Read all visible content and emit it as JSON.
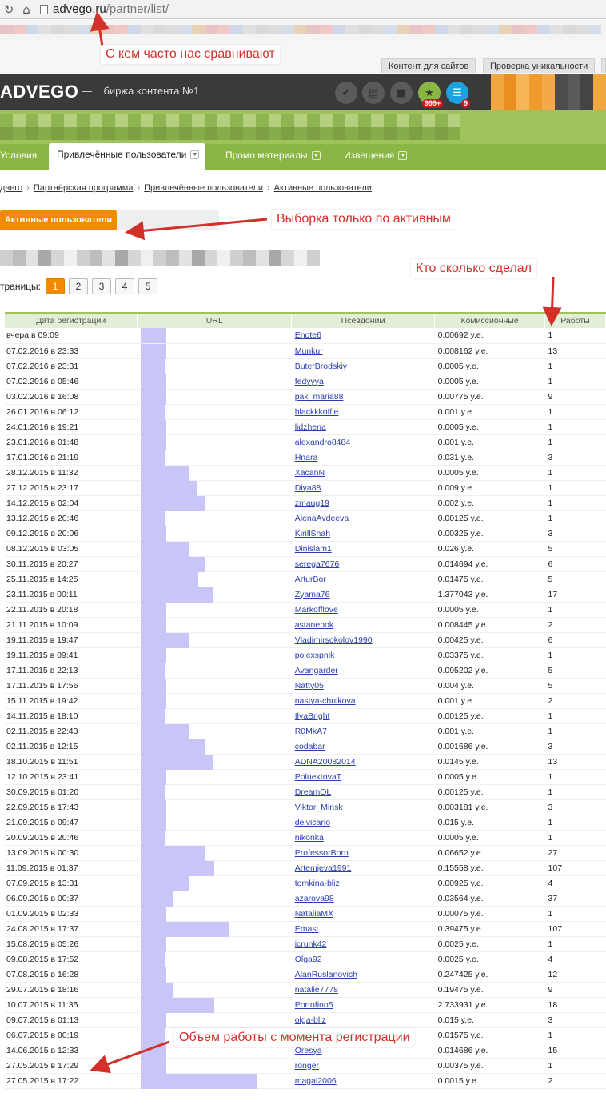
{
  "browser": {
    "url_host": "advego.ru",
    "url_path": "/partner/list/"
  },
  "top_tabs": [
    "Контент для сайтов",
    "Проверка уникальности"
  ],
  "annotations": {
    "compare": "С кем часто нас сравнивают",
    "active_only": "Выборка только по активным",
    "who_did": "Кто сколько сделал",
    "volume": "Объем работы с момента регистрации"
  },
  "header": {
    "logo": "ADVEGO",
    "dash": "—",
    "slogan": "биржа контента №1",
    "badge_star": "999+",
    "badge_list": "9",
    "icons": [
      "check-icon",
      "document-icon",
      "folder-icon",
      "star-icon",
      "list-icon"
    ]
  },
  "nav": {
    "items": [
      {
        "label": "Условия",
        "dropdown": false,
        "active": false
      },
      {
        "label": "Привлечённые пользователи",
        "dropdown": true,
        "active": true
      },
      {
        "label": "Промо материалы",
        "dropdown": true,
        "active": false
      },
      {
        "label": "Извещения",
        "dropdown": true,
        "active": false
      }
    ]
  },
  "breadcrumb": [
    "двего",
    "Партнёрская программа",
    "Привлечённые пользователи",
    "Активные пользователи"
  ],
  "filter_button": "Активные пользователи",
  "pagination": {
    "label": "траницы:",
    "pages": [
      "1",
      "2",
      "3",
      "4",
      "5"
    ],
    "current": "1"
  },
  "table": {
    "headers": [
      "Дата регистрации",
      "URL",
      "Псевдоним",
      "Комиссионные",
      "Работы"
    ],
    "rows": [
      {
        "date": "вчера в 09:09",
        "nick": "Enote6",
        "comm": "0.00692 y.e.",
        "work": "1"
      },
      {
        "date": "07.02.2016 в 23:33",
        "nick": "Munkur",
        "comm": "0.008162 y.e.",
        "work": "13"
      },
      {
        "date": "07.02.2016 в 23:31",
        "nick": "ButerBrodskiy",
        "comm": "0.0005 y.e.",
        "work": "1"
      },
      {
        "date": "07.02.2016 в 05:46",
        "nick": "fedyyya",
        "comm": "0.0005 y.e.",
        "work": "1"
      },
      {
        "date": "03.02.2016 в 16:08",
        "nick": "pak_maria88",
        "comm": "0.00775 y.e.",
        "work": "9"
      },
      {
        "date": "26.01.2016 в 06:12",
        "nick": "blackkkoffie",
        "comm": "0.001 y.e.",
        "work": "1"
      },
      {
        "date": "24.01.2016 в 19:21",
        "nick": "lidzhena",
        "comm": "0.0005 y.e.",
        "work": "1"
      },
      {
        "date": "23.01.2016 в 01:48",
        "nick": "alexandro8484",
        "comm": "0.001 y.e.",
        "work": "1"
      },
      {
        "date": "17.01.2016 в 21:19",
        "nick": "Hnara",
        "comm": "0.031 y.e.",
        "work": "3"
      },
      {
        "date": "28.12.2015 в 11:32",
        "nick": "XacanN",
        "comm": "0.0005 y.e.",
        "work": "1"
      },
      {
        "date": "27.12.2015 в 23:17",
        "nick": "Diya88",
        "comm": "0.009 y.e.",
        "work": "1"
      },
      {
        "date": "14.12.2015 в 02:04",
        "nick": "zmaug19",
        "comm": "0.002 y.e.",
        "work": "1"
      },
      {
        "date": "13.12.2015 в 20:46",
        "nick": "AlenaAvdeeva",
        "comm": "0.00125 y.e.",
        "work": "1"
      },
      {
        "date": "09.12.2015 в 20:06",
        "nick": "KirillShah",
        "comm": "0.00325 y.e.",
        "work": "3"
      },
      {
        "date": "08.12.2015 в 03:05",
        "nick": "Dinislam1",
        "comm": "0.026 y.e.",
        "work": "5"
      },
      {
        "date": "30.11.2015 в 20:27",
        "nick": "serega7676",
        "comm": "0.014694 y.e.",
        "work": "6"
      },
      {
        "date": "25.11.2015 в 14:25",
        "nick": "ArturBor",
        "comm": "0.01475 y.e.",
        "work": "5"
      },
      {
        "date": "23.11.2015 в 00:11",
        "nick": "Zyama76",
        "comm": "1.377043 y.e.",
        "work": "17"
      },
      {
        "date": "22.11.2015 в 20:18",
        "nick": "Markofflove",
        "comm": "0.0005 y.e.",
        "work": "1"
      },
      {
        "date": "21.11.2015 в 10:09",
        "nick": "astanenok",
        "comm": "0.008445 y.e.",
        "work": "2"
      },
      {
        "date": "19.11.2015 в 19:47",
        "nick": "Vladimirsokolov1990",
        "comm": "0.00425 y.e.",
        "work": "6"
      },
      {
        "date": "19.11.2015 в 09:41",
        "nick": "polexspnik",
        "comm": "0.03375 y.e.",
        "work": "1"
      },
      {
        "date": "17.11.2015 в 22:13",
        "nick": "Avangarder",
        "comm": "0.095202 y.e.",
        "work": "5"
      },
      {
        "date": "17.11.2015 в 17:56",
        "nick": "Natty05",
        "comm": "0.004 y.e.",
        "work": "5"
      },
      {
        "date": "15.11.2015 в 19:42",
        "nick": "nastya-chulkova",
        "comm": "0.001 y.e.",
        "work": "2"
      },
      {
        "date": "14.11.2015 в 18:10",
        "nick": "IlyaBright",
        "comm": "0.00125 y.e.",
        "work": "1"
      },
      {
        "date": "02.11.2015 в 22:43",
        "nick": "R0MkA7",
        "comm": "0.001 y.e.",
        "work": "1"
      },
      {
        "date": "02.11.2015 в 12:15",
        "nick": "codabar",
        "comm": "0.001686 y.e.",
        "work": "3"
      },
      {
        "date": "18.10.2015 в 11:51",
        "nick": "ADNA20082014",
        "comm": "0.0145 y.e.",
        "work": "13"
      },
      {
        "date": "12.10.2015 в 23:41",
        "nick": "PoluektovaT",
        "comm": "0.0005 y.e.",
        "work": "1"
      },
      {
        "date": "30.09.2015 в 01:20",
        "nick": "DreamOL",
        "comm": "0.00125 y.e.",
        "work": "1"
      },
      {
        "date": "22.09.2015 в 17:43",
        "nick": "Viktor_Minsk",
        "comm": "0.003181 y.e.",
        "work": "3"
      },
      {
        "date": "21.09.2015 в 09:47",
        "nick": "delvicario",
        "comm": "0.015 y.e.",
        "work": "1"
      },
      {
        "date": "20.09.2015 в 20:46",
        "nick": "nikonka",
        "comm": "0.0005 y.e.",
        "work": "1"
      },
      {
        "date": "13.09.2015 в 00:30",
        "nick": "ProfessorBorn",
        "comm": "0.06652 y.e.",
        "work": "27"
      },
      {
        "date": "11.09.2015 в 01:37",
        "nick": "Artemjeva1991",
        "comm": "0.15558 y.e.",
        "work": "107"
      },
      {
        "date": "07.09.2015 в 13:31",
        "nick": "tomkina-bliz",
        "comm": "0.00925 y.e.",
        "work": "4"
      },
      {
        "date": "06.09.2015 в 00:37",
        "nick": "azarova98",
        "comm": "0.03564 y.e.",
        "work": "37"
      },
      {
        "date": "01.09.2015 в 02:33",
        "nick": "NataliaMX",
        "comm": "0.00075 y.e.",
        "work": "1"
      },
      {
        "date": "24.08.2015 в 17:37",
        "nick": "Emast",
        "comm": "0.39475 y.e.",
        "work": "107"
      },
      {
        "date": "15.08.2015 в 05:26",
        "nick": "icrunk42",
        "comm": "0.0025 y.e.",
        "work": "1"
      },
      {
        "date": "09.08.2015 в 17:52",
        "nick": "Olga92",
        "comm": "0.0025 y.e.",
        "work": "4"
      },
      {
        "date": "07.08.2015 в 16:28",
        "nick": "AlanRuslanovich",
        "comm": "0.247425 y.e.",
        "work": "12"
      },
      {
        "date": "29.07.2015 в 18:16",
        "nick": "natalie7778",
        "comm": "0.19475 y.e.",
        "work": "9"
      },
      {
        "date": "10.07.2015 в 11:35",
        "nick": "Portofino5",
        "comm": "2.733931 y.e.",
        "work": "18"
      },
      {
        "date": "09.07.2015 в 01:13",
        "nick": "olga-bliz",
        "comm": "0.015 y.e.",
        "work": "3"
      },
      {
        "date": "06.07.2015 в 00:19",
        "nick": "",
        "comm": "0.01575 y.e.",
        "work": "1"
      },
      {
        "date": "14.06.2015 в 12:33",
        "nick": "Oresya",
        "comm": "0.014686 y.e.",
        "work": "15"
      },
      {
        "date": "27.05.2015 в 17:29",
        "nick": "ronger",
        "comm": "0.00375 y.e.",
        "work": "1"
      },
      {
        "date": "27.05.2015 в 17:22",
        "nick": "magal2006",
        "comm": "0.0015 y.e.",
        "work": "2"
      }
    ]
  },
  "colors": {
    "header_bg": "#3a3a3a",
    "nav_green": "#8ab743",
    "accent_orange": "#f08a00",
    "annotation_red": "#d3302a",
    "link_blue": "#2a3fae"
  }
}
